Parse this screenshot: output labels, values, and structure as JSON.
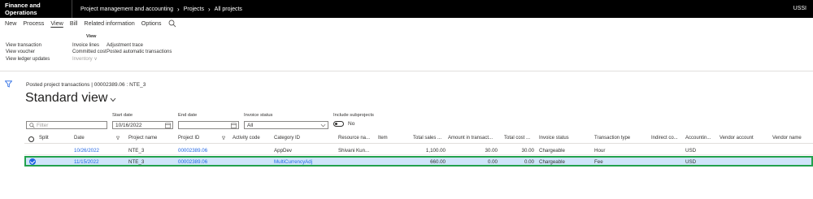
{
  "topbar": {
    "app_title": "Finance and Operations",
    "breadcrumb": [
      "Project management and accounting",
      "Projects",
      "All projects"
    ],
    "company": "USSI"
  },
  "actionpane": {
    "tabs": [
      "New",
      "Process",
      "View",
      "Bill",
      "Related information",
      "Options"
    ],
    "active_tab": "View",
    "group_title": "View",
    "col1": [
      "View transaction",
      "View voucher",
      "View ledger updates"
    ],
    "col2": [
      "Invoice lines",
      "Committed cost",
      "Inventory"
    ],
    "col3": [
      "Adjustment trace",
      "Posted automatic transactions"
    ]
  },
  "page": {
    "caption": "Posted project transactions  |  00002389.06 : NTE_3",
    "view_title": "Standard view"
  },
  "filters": {
    "filter_placeholder": "Filter",
    "start_date_label": "Start date",
    "start_date_value": "10/16/2022",
    "end_date_label": "End date",
    "end_date_value": "",
    "invoice_status_label": "Invoice status",
    "invoice_status_value": "All",
    "include_subprojects_label": "Include subprojects",
    "include_subprojects_value": "No"
  },
  "grid": {
    "columns": [
      "Split",
      "Date",
      "Project name",
      "Project ID",
      "Activity code",
      "Category ID",
      "Resource na...",
      "Item",
      "Total sales ...",
      "Amount in transact...",
      "Total cost ...",
      "Invoice status",
      "Transaction type",
      "Indirect co...",
      "Accountin...",
      "Vendor account",
      "Vendor name"
    ],
    "rows": [
      {
        "date": "10/26/2022",
        "project_name": "NTE_3",
        "project_id": "00002389.06",
        "activity_code": "",
        "category_id": "AppDev",
        "resource": "Shivani Kun...",
        "item": "",
        "total_sales": "1,100.00",
        "amount": "30.00",
        "total_cost": "30.00",
        "invoice_status": "Chargeable",
        "transaction_type": "Hour",
        "indirect": "",
        "accounting": "USD",
        "vendor_account": "",
        "vendor_name": ""
      },
      {
        "date": "11/15/2022",
        "project_name": "NTE_3",
        "project_id": "00002389.06",
        "activity_code": "",
        "category_id": "MultiCurrencyAdj",
        "resource": "",
        "item": "",
        "total_sales": "660.00",
        "amount": "0.00",
        "total_cost": "0.00",
        "invoice_status": "Chargeable",
        "transaction_type": "Fee",
        "indirect": "",
        "accounting": "USD",
        "vendor_account": "",
        "vendor_name": ""
      }
    ]
  },
  "colors": {
    "selection_bg": "#cfe4fa",
    "selection_border": "#23a24d",
    "link": "#2266e3",
    "topbar_bg": "#000000"
  }
}
